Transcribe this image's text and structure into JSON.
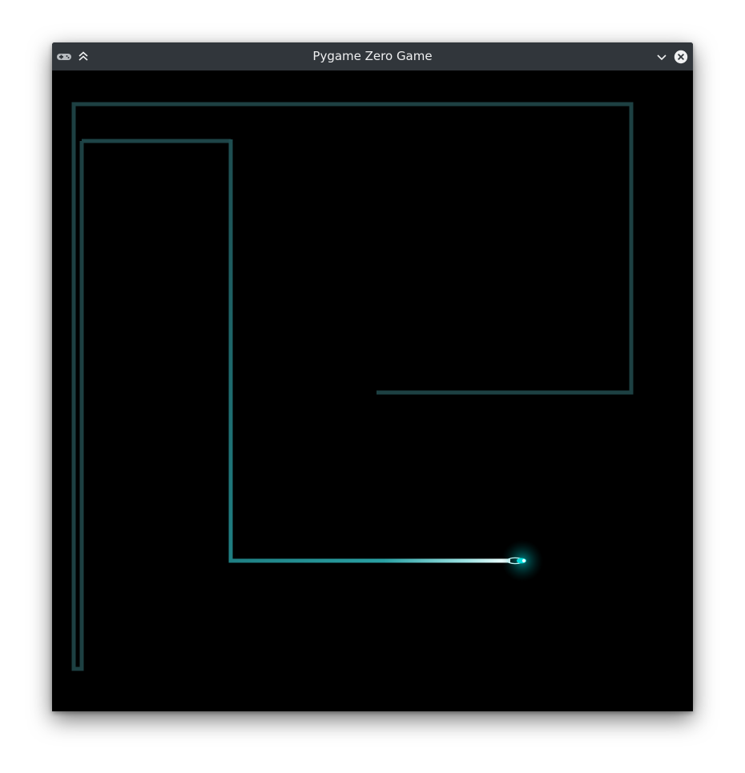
{
  "window": {
    "title": "Pygame Zero Game",
    "icons": {
      "app": "gamepad-icon",
      "keep_above": "keep-above-icon",
      "minimize": "chevron-down-icon",
      "close": "close-icon"
    },
    "colors": {
      "titlebar_bg": "#31363b",
      "title_text": "#eff0f1",
      "canvas_bg": "#000000"
    }
  },
  "game": {
    "trail_colors": {
      "old": "#1d4042",
      "recent": "#1f7f83",
      "head": "#e8ffff",
      "glow": "#00e5e5"
    }
  }
}
